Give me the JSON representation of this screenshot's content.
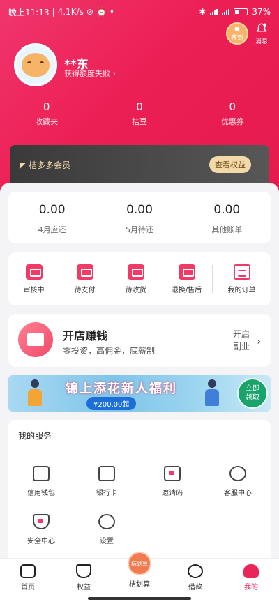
{
  "status_bar": {
    "time": "晚上11:13",
    "speed": "4.1K/s",
    "battery": "37",
    "battery_suffix": "%"
  },
  "header": {
    "sign_label": "签到",
    "message_label": "消息",
    "user_name": "**东",
    "user_sub": "获得额度失败",
    "stats": [
      {
        "value": "0",
        "label": "收藏夹"
      },
      {
        "value": "0",
        "label": "桔豆"
      },
      {
        "value": "0",
        "label": "优惠券"
      }
    ]
  },
  "vip": {
    "title": "桔多多会员",
    "button": "查看权益"
  },
  "bills": [
    {
      "value": "0.00",
      "label": "4月应还"
    },
    {
      "value": "0.00",
      "label": "5月待还"
    },
    {
      "value": "0.00",
      "label": "其他账单"
    }
  ],
  "orders": {
    "items": [
      "审核中",
      "待支付",
      "待收货",
      "退换/售后"
    ],
    "my_orders": "我的订单"
  },
  "shop": {
    "title": "开店赚钱",
    "subtitle": "零投资，高佣金，底薪制",
    "right_line1": "开启",
    "right_line2": "副业"
  },
  "banner": {
    "title": "锦上添花新人福利",
    "amount": "¥200.00起",
    "cta_line1": "立即",
    "cta_line2": "领取"
  },
  "services": {
    "title": "我的服务",
    "items": [
      "信用钱包",
      "银行卡",
      "邀请码",
      "客服中心",
      "安全中心",
      "设置"
    ]
  },
  "tabbar": {
    "items": [
      "首页",
      "权益",
      "桔划算",
      "借款",
      "我的"
    ],
    "center_badge": "桔划算"
  },
  "colors": {
    "brand": "#e8265a",
    "header_gradient_start": "#f0366c",
    "vip_gold": "#f1d9a6"
  }
}
